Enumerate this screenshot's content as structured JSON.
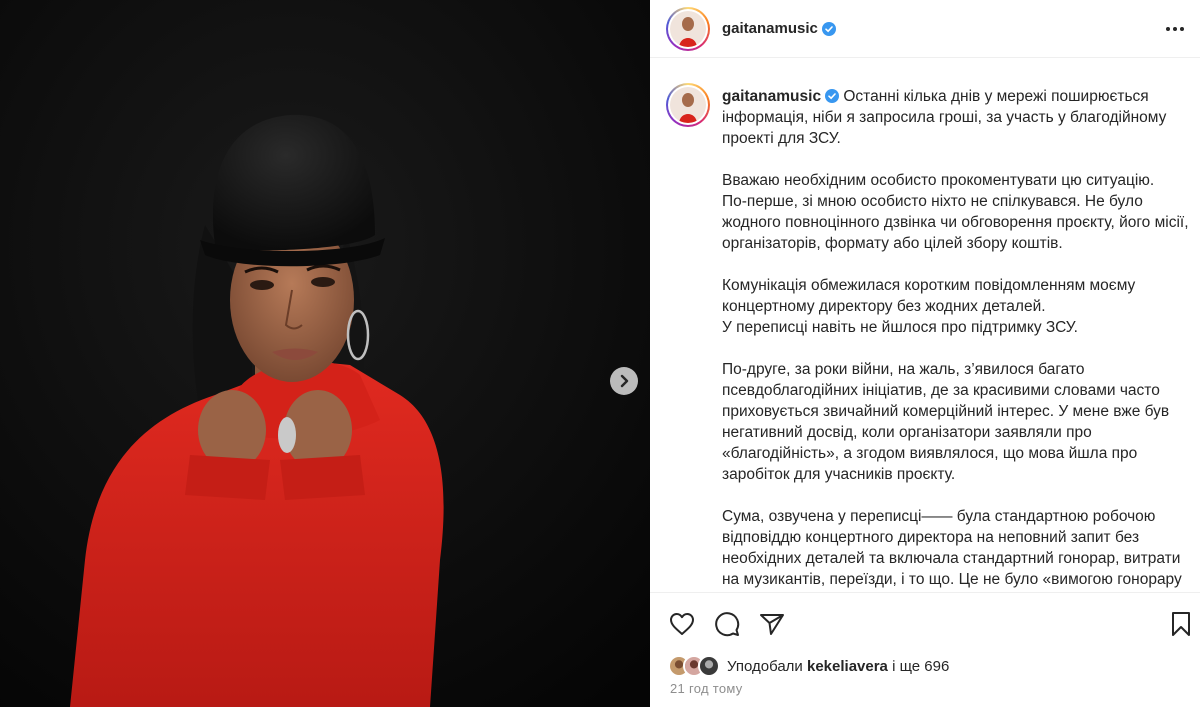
{
  "post": {
    "username": "gaitanamusic",
    "verified": true,
    "caption_text": " Останні кілька днів у мережі поширюється інформація, ніби я запросила гроші, за участь у благодійному проекті для ЗСУ.\n\nВважаю необхідним особисто прокоментувати цю ситуацію.\nПо-перше, зі мною особисто ніхто не спілкувався. Не було жодного повноцінного дзвінка чи обговорення проєкту, його місії, організаторів, формату або цілей збору коштів.\n\nКомунікація обмежилася коротким повідомленням моєму концертному директору без жодних деталей.\nУ переписці навіть не йшлося про підтримку ЗСУ.\n\nПо-друге, за роки війни, на жаль, з’явилося багато псевдоблагодійних ініціатив, де за красивими словами часто приховується звичайний комерційний інтерес. У мене вже був негативний досвід, коли організатори заявляли про «благодійність», а згодом виявлялося, що мова йшла про заробіток для учасників проєкту.\n\nСума, озвучена у переписці—— була стандартною робочою відповіддю концертного директора на неповний запит без необхідних деталей та включала стандартний гонорар, витрати на музикантів, переїзди, і то що. Це не було «вимогою гонорару за благодійність ДЛЯ ЗСУ!!!», як зараз",
    "likes_prefix": "Уподобали ",
    "likes_user": "kekeliavera",
    "likes_suffix": " і ще 696",
    "time_ago": "21 год тому"
  },
  "icons": {
    "header_more": "more-horizontal-icon",
    "next": "chevron-right-icon",
    "like": "heart-icon",
    "comment": "comment-icon",
    "share": "paper-plane-icon",
    "save": "bookmark-icon",
    "verified": "verified-badge-icon"
  },
  "colors": {
    "verified_blue": "#3897f0",
    "sweater_red": "#d8241c",
    "border": "#efefef",
    "muted": "#8e8e8e"
  }
}
